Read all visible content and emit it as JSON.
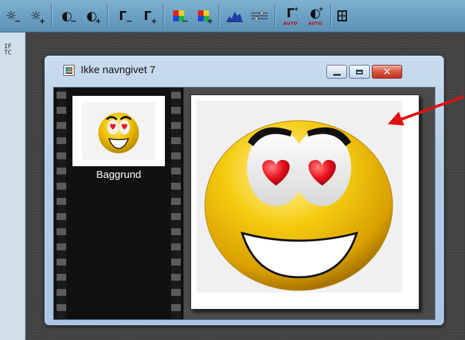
{
  "toolbar": {
    "buttons": [
      {
        "icon": "brightness-decrease-icon"
      },
      {
        "icon": "brightness-increase-icon"
      },
      {
        "icon": "contrast-decrease-icon"
      },
      {
        "icon": "contrast-increase-icon"
      },
      {
        "icon": "gamma-decrease-icon"
      },
      {
        "icon": "gamma-increase-icon"
      },
      {
        "icon": "saturation-decrease-icon"
      },
      {
        "icon": "saturation-increase-icon"
      },
      {
        "icon": "histogram-icon"
      },
      {
        "icon": "levels-icon"
      },
      {
        "icon": "auto-gamma-icon",
        "badge": "AUTO"
      },
      {
        "icon": "auto-contrast-icon",
        "badge": "AUTO"
      },
      {
        "icon": "grid-icon"
      }
    ]
  },
  "left_pane": {
    "text_line1": "IF",
    "text_line2": "TC"
  },
  "window": {
    "title": "Ikke navngivet 7",
    "icon": "image-document-icon",
    "controls": {
      "minimize": "minimize-icon",
      "maximize": "maximize-icon",
      "close": "close-icon"
    }
  },
  "layers": [
    {
      "name": "Baggrund",
      "thumbnail": "smiley-heart-eyes"
    }
  ],
  "canvas": {
    "image": "smiley-heart-eyes"
  },
  "annotation": {
    "arrow_color": "#e01010"
  }
}
